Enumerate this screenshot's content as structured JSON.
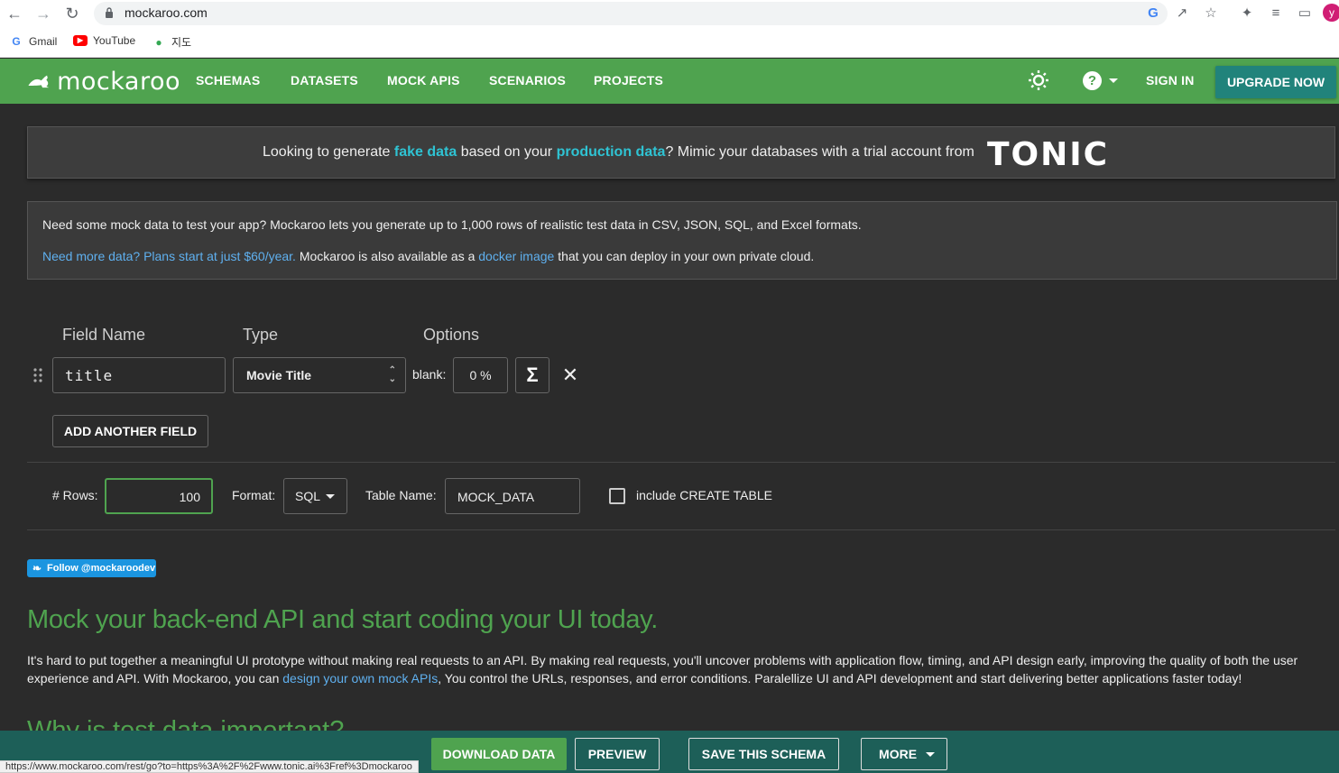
{
  "browser": {
    "url": "mockaroo.com",
    "bookmarks": [
      "Gmail",
      "YouTube",
      "지도"
    ],
    "avatar_letter": "y",
    "status_url": "https://www.mockaroo.com/rest/go?to=https%3A%2F%2Fwww.tonic.ai%3Fref%3Dmockaroo"
  },
  "header": {
    "logo": "mockaroo",
    "nav": [
      "SCHEMAS",
      "DATASETS",
      "MOCK APIS",
      "SCENARIOS",
      "PROJECTS"
    ],
    "sign_in": "SIGN IN",
    "upgrade": "UPGRADE NOW",
    "accent": "#4fa34f"
  },
  "banner": {
    "pre": "Looking to generate ",
    "fake": "fake data",
    "mid": " based on your ",
    "production": "production data",
    "post": "? Mimic your databases with a trial account from",
    "brand": "TONIC"
  },
  "info": {
    "line1": "Need some mock data to test your app? Mockaroo lets you generate up to 1,000 rows of realistic test data in CSV, JSON, SQL, and Excel formats.",
    "line2_link": "Need more data? Plans start at just $60/year.",
    "line2_mid": " Mockaroo is also available as a ",
    "line2_link2": "docker image",
    "line2_post": " that you can deploy in your own private cloud."
  },
  "fields": {
    "headers": [
      "Field Name",
      "Type",
      "Options"
    ],
    "row": {
      "name": "title",
      "type": "Movie Title",
      "blank_label": "blank:",
      "blank_value": "0 %"
    },
    "add": "ADD ANOTHER FIELD"
  },
  "settings": {
    "rows_label": "# Rows:",
    "rows_value": "100",
    "format_label": "Format:",
    "format_value": "SQL",
    "table_label": "Table Name:",
    "table_value": "MOCK_DATA",
    "create_table_label": "include CREATE TABLE"
  },
  "twitter": "Follow @mockaroodev",
  "content": {
    "heading": "Mock your back-end API and start coding your UI today.",
    "para_pre": "It's hard to put together a meaningful UI prototype without making real requests to an API. By making real requests, you'll uncover problems with application flow, timing, and API design early, improving the quality of both the user experience and API. With Mockaroo, you can ",
    "para_link": "design your own mock APIs",
    "para_post": ", You control the URLs, responses, and error conditions. Paralellize UI and API development and start delivering better applications faster today!",
    "heading2": "Why is test data important?"
  },
  "footer": {
    "download": "DOWNLOAD DATA",
    "preview": "PREVIEW",
    "save": "SAVE THIS SCHEMA",
    "more": "MORE"
  }
}
